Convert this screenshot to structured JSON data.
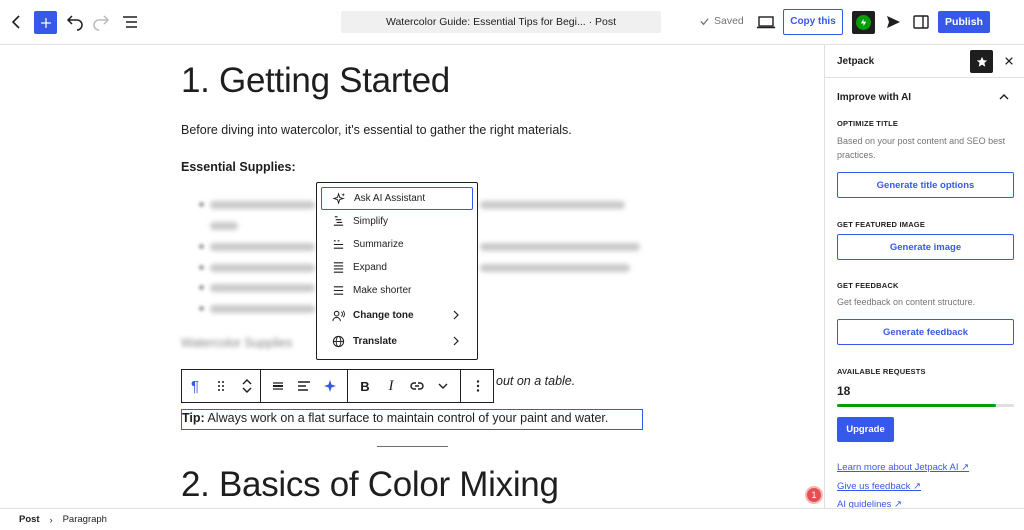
{
  "topbar": {
    "doc_title": "Watercolor Guide: Essential Tips for Begi... · Post",
    "saved_label": "Saved",
    "copy_label": "Copy this",
    "publish_label": "Publish"
  },
  "editor": {
    "heading1": "1. Getting Started",
    "intro": "Before diving into watercolor, it's essential to gather the right materials.",
    "supplies_heading": "Essential Supplies:",
    "image_alt": "Watercolor Supplies",
    "italic_visible": "out on a table.",
    "tip_label": "Tip:",
    "tip_text": " Always work on a flat surface to maintain control of your paint and water.",
    "heading2": "2. Basics of Color Mixing"
  },
  "ai_menu": {
    "items": [
      {
        "label": "Ask AI Assistant",
        "icon": "sparkle-icon"
      },
      {
        "label": "Simplify",
        "icon": "simplify-icon"
      },
      {
        "label": "Summarize",
        "icon": "summarize-icon"
      },
      {
        "label": "Expand",
        "icon": "expand-icon"
      },
      {
        "label": "Make shorter",
        "icon": "make-shorter-icon"
      },
      {
        "label": "Change tone",
        "icon": "tone-icon"
      },
      {
        "label": "Translate",
        "icon": "globe-icon"
      }
    ]
  },
  "sidebar": {
    "title": "Jetpack",
    "panel_title": "Improve with AI",
    "optimize_label": "OPTIMIZE TITLE",
    "optimize_desc": "Based on your post content and SEO best practices.",
    "optimize_button": "Generate title options",
    "featured_label": "GET FEATURED IMAGE",
    "featured_button": "Generate image",
    "feedback_label": "GET FEEDBACK",
    "feedback_desc": "Get feedback on content structure.",
    "feedback_button": "Generate feedback",
    "requests_label": "AVAILABLE REQUESTS",
    "requests_count": "18",
    "requests_progress": 0.9,
    "upgrade_button": "Upgrade",
    "link_learn": "Learn more about Jetpack AI ↗",
    "link_feedback": "Give us feedback ↗",
    "link_guidelines": "AI guidelines ↗"
  },
  "footer": {
    "crumb_post": "Post",
    "crumb_paragraph": "Paragraph"
  },
  "notification_count": "1",
  "colors": {
    "accent": "#3858e9",
    "jetpack_green": "#069e08",
    "text": "#1e1e1e"
  }
}
